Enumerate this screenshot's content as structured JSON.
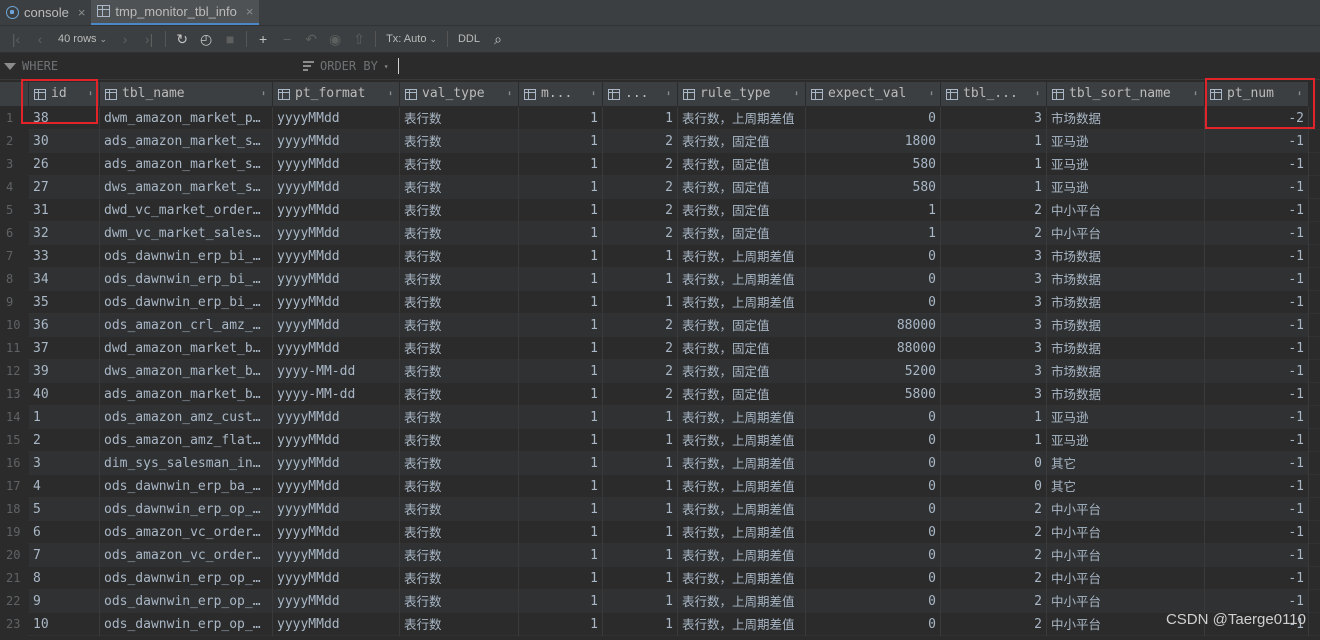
{
  "tabs": [
    {
      "label": "console",
      "icon": "console-icon",
      "active": false
    },
    {
      "label": "tmp_monitor_tbl_info",
      "icon": "table-icon",
      "active": true
    }
  ],
  "toolbar": {
    "rows_label": "40 rows",
    "tx_label": "Tx: Auto",
    "ddl_label": "DDL"
  },
  "filter": {
    "where_placeholder": "WHERE",
    "order_placeholder": "ORDER BY"
  },
  "columns": [
    "id",
    "tbl_name",
    "pt_format",
    "val_type",
    "m...",
    "...",
    "rule_type",
    "expect_val",
    "tbl_...",
    "tbl_sort_name",
    "pt_num"
  ],
  "rows": [
    [
      "1",
      "38",
      "dwm_amazon_market_p…",
      "yyyyMMdd",
      "表行数",
      "1",
      "1",
      "表行数，上周期差值",
      "0",
      "3",
      "市场数据",
      "-2"
    ],
    [
      "2",
      "30",
      "ads_amazon_market_s…",
      "yyyyMMdd",
      "表行数",
      "1",
      "2",
      "表行数，固定值",
      "1800",
      "1",
      "亚马逊",
      "-1"
    ],
    [
      "3",
      "26",
      "ads_amazon_market_s…",
      "yyyyMMdd",
      "表行数",
      "1",
      "2",
      "表行数，固定值",
      "580",
      "1",
      "亚马逊",
      "-1"
    ],
    [
      "4",
      "27",
      "dws_amazon_market_s…",
      "yyyyMMdd",
      "表行数",
      "1",
      "2",
      "表行数，固定值",
      "580",
      "1",
      "亚马逊",
      "-1"
    ],
    [
      "5",
      "31",
      "dwd_vc_market_order…",
      "yyyyMMdd",
      "表行数",
      "1",
      "2",
      "表行数，固定值",
      "1",
      "2",
      "中小平台",
      "-1"
    ],
    [
      "6",
      "32",
      "dwm_vc_market_sales…",
      "yyyyMMdd",
      "表行数",
      "1",
      "2",
      "表行数，固定值",
      "1",
      "2",
      "中小平台",
      "-1"
    ],
    [
      "7",
      "33",
      "ods_dawnwin_erp_bi_…",
      "yyyyMMdd",
      "表行数",
      "1",
      "1",
      "表行数，上周期差值",
      "0",
      "3",
      "市场数据",
      "-1"
    ],
    [
      "8",
      "34",
      "ods_dawnwin_erp_bi_…",
      "yyyyMMdd",
      "表行数",
      "1",
      "1",
      "表行数，上周期差值",
      "0",
      "3",
      "市场数据",
      "-1"
    ],
    [
      "9",
      "35",
      "ods_dawnwin_erp_bi_…",
      "yyyyMMdd",
      "表行数",
      "1",
      "1",
      "表行数，上周期差值",
      "0",
      "3",
      "市场数据",
      "-1"
    ],
    [
      "10",
      "36",
      "ods_amazon_crl_amz_…",
      "yyyyMMdd",
      "表行数",
      "1",
      "2",
      "表行数，固定值",
      "88000",
      "3",
      "市场数据",
      "-1"
    ],
    [
      "11",
      "37",
      "dwd_amazon_market_b…",
      "yyyyMMdd",
      "表行数",
      "1",
      "2",
      "表行数，固定值",
      "88000",
      "3",
      "市场数据",
      "-1"
    ],
    [
      "12",
      "39",
      "dws_amazon_market_b…",
      "yyyy-MM-dd",
      "表行数",
      "1",
      "2",
      "表行数，固定值",
      "5200",
      "3",
      "市场数据",
      "-1"
    ],
    [
      "13",
      "40",
      "ads_amazon_market_b…",
      "yyyy-MM-dd",
      "表行数",
      "1",
      "2",
      "表行数，固定值",
      "5800",
      "3",
      "市场数据",
      "-1"
    ],
    [
      "14",
      "1",
      "ods_amazon_amz_cust…",
      "yyyyMMdd",
      "表行数",
      "1",
      "1",
      "表行数，上周期差值",
      "0",
      "1",
      "亚马逊",
      "-1"
    ],
    [
      "15",
      "2",
      "ods_amazon_amz_flat…",
      "yyyyMMdd",
      "表行数",
      "1",
      "1",
      "表行数，上周期差值",
      "0",
      "1",
      "亚马逊",
      "-1"
    ],
    [
      "16",
      "3",
      "dim_sys_salesman_in…",
      "yyyyMMdd",
      "表行数",
      "1",
      "1",
      "表行数，上周期差值",
      "0",
      "0",
      "其它",
      "-1"
    ],
    [
      "17",
      "4",
      "ods_dawnwin_erp_ba_…",
      "yyyyMMdd",
      "表行数",
      "1",
      "1",
      "表行数，上周期差值",
      "0",
      "0",
      "其它",
      "-1"
    ],
    [
      "18",
      "5",
      "ods_dawnwin_erp_op_…",
      "yyyyMMdd",
      "表行数",
      "1",
      "1",
      "表行数，上周期差值",
      "0",
      "2",
      "中小平台",
      "-1"
    ],
    [
      "19",
      "6",
      "ods_amazon_vc_order…",
      "yyyyMMdd",
      "表行数",
      "1",
      "1",
      "表行数，上周期差值",
      "0",
      "2",
      "中小平台",
      "-1"
    ],
    [
      "20",
      "7",
      "ods_amazon_vc_order…",
      "yyyyMMdd",
      "表行数",
      "1",
      "1",
      "表行数，上周期差值",
      "0",
      "2",
      "中小平台",
      "-1"
    ],
    [
      "21",
      "8",
      "ods_dawnwin_erp_op_…",
      "yyyyMMdd",
      "表行数",
      "1",
      "1",
      "表行数，上周期差值",
      "0",
      "2",
      "中小平台",
      "-1"
    ],
    [
      "22",
      "9",
      "ods_dawnwin_erp_op_…",
      "yyyyMMdd",
      "表行数",
      "1",
      "1",
      "表行数，上周期差值",
      "0",
      "2",
      "中小平台",
      "-1"
    ],
    [
      "23",
      "10",
      "ods_dawnwin_erp_op_…",
      "yyyyMMdd",
      "表行数",
      "1",
      "1",
      "表行数，上周期差值",
      "0",
      "2",
      "中小平台",
      "-1"
    ]
  ],
  "watermark": "CSDN @Taerge0110",
  "colors": {
    "accent": "#4a88c7",
    "highlight": "#e0242a"
  }
}
